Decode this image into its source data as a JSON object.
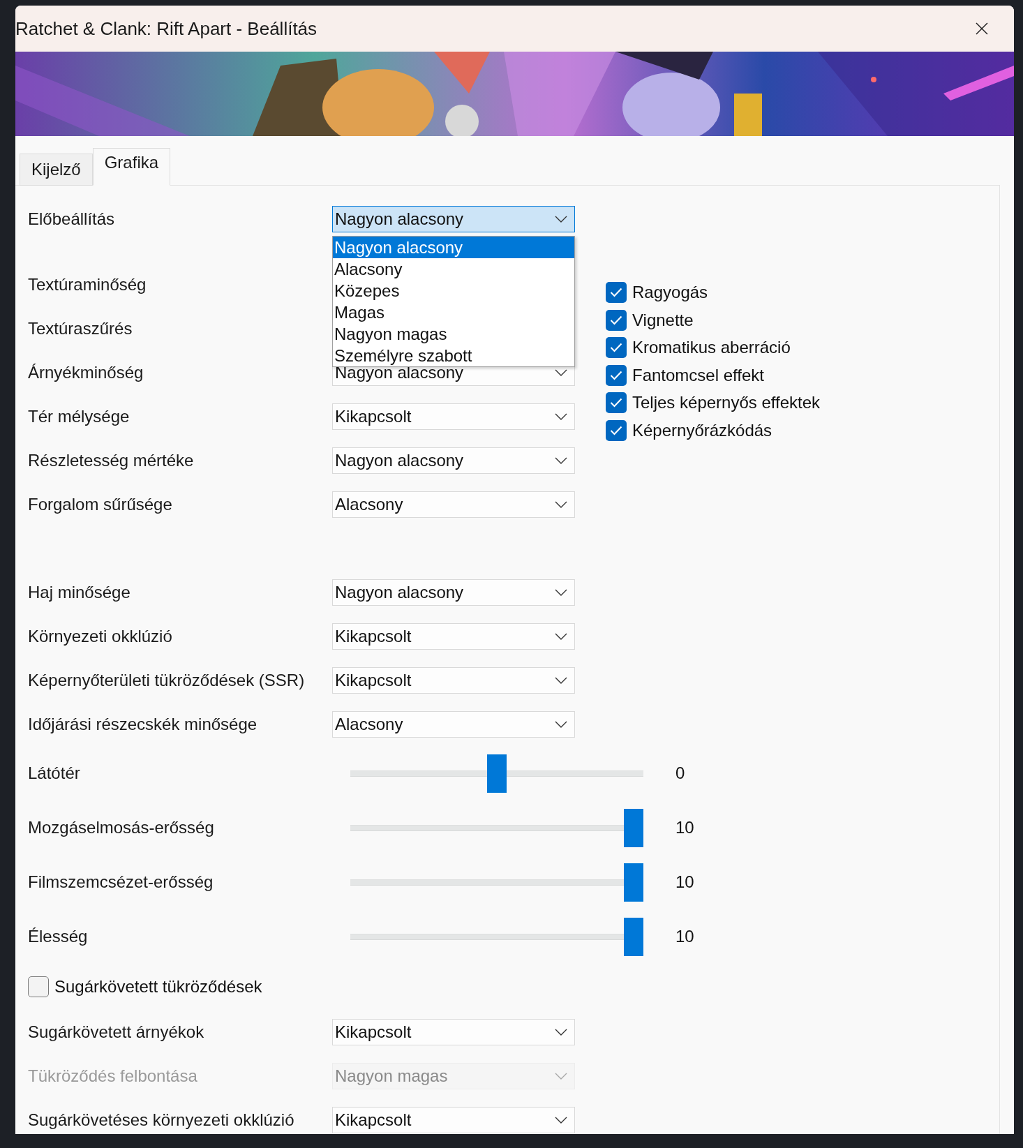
{
  "window": {
    "title": "Ratchet & Clank: Rift Apart - Beállítás"
  },
  "tabs": [
    {
      "label": "Kijelző",
      "selected": false
    },
    {
      "label": "Grafika",
      "selected": true
    }
  ],
  "settings": {
    "groups": [
      [
        {
          "kind": "dropdown",
          "label": "Előbeállítás",
          "value": "Nagyon alacsony",
          "disabled": false,
          "open": true,
          "options": [
            {
              "label": "Nagyon alacsony",
              "selected": true
            },
            {
              "label": "Alacsony",
              "selected": false
            },
            {
              "label": "Közepes",
              "selected": false
            },
            {
              "label": "Magas",
              "selected": false
            },
            {
              "label": "Nagyon magas",
              "selected": false
            },
            {
              "label": "Személyre szabott",
              "selected": false
            }
          ]
        },
        {
          "kind": "dropdown",
          "label": "Textúraminőség",
          "disabled": false
        },
        {
          "kind": "dropdown",
          "label": "Textúraszűrés",
          "disabled": false
        },
        {
          "kind": "dropdown",
          "label": "Árnyékminőség",
          "value": "Nagyon alacsony",
          "disabled": false
        },
        {
          "kind": "dropdown",
          "label": "Tér mélysége",
          "value": "Kikapcsolt",
          "disabled": false
        },
        {
          "kind": "dropdown",
          "label": "Részletesség mértéke",
          "value": "Nagyon alacsony",
          "disabled": false
        },
        {
          "kind": "dropdown",
          "label": "Forgalom sűrűsége",
          "value": "Alacsony",
          "disabled": false
        }
      ],
      [
        {
          "kind": "dropdown",
          "label": "Haj minősége",
          "value": "Nagyon alacsony",
          "disabled": false
        },
        {
          "kind": "dropdown",
          "label": "Környezeti okklúzió",
          "value": "Kikapcsolt",
          "disabled": false
        },
        {
          "kind": "dropdown",
          "label": "Képernyőterületi tükröződések (SSR)",
          "value": "Kikapcsolt",
          "disabled": false
        },
        {
          "kind": "dropdown",
          "label": "Időjárási részecskék minősége",
          "value": "Alacsony",
          "disabled": false
        },
        {
          "kind": "slider",
          "label": "Látótér",
          "level": 0.5,
          "reading": "0"
        },
        {
          "kind": "slider",
          "label": "Mozgáselmosás-erősség",
          "level": 1,
          "reading": "10"
        },
        {
          "kind": "slider",
          "label": "Filmszemcsézet-erősség",
          "level": 1,
          "reading": "10"
        },
        {
          "kind": "slider",
          "label": "Élesség",
          "level": 1,
          "reading": "10"
        },
        {
          "kind": "checkbox",
          "label": "Sugárkövetett tükröződések",
          "checked": false
        },
        {
          "kind": "dropdown",
          "label": "Sugárkövetett árnyékok",
          "value": "Kikapcsolt",
          "disabled": false
        },
        {
          "kind": "dropdown",
          "label": "Tükröződés felbontása",
          "value": "Nagyon magas",
          "disabled": true
        },
        {
          "kind": "dropdown",
          "label": "Sugárkövetéses környezeti okklúzió",
          "value": "Kikapcsolt",
          "disabled": false
        }
      ]
    ],
    "effects": [
      {
        "label": "Ragyogás",
        "checked": true
      },
      {
        "label": "Vignette",
        "checked": true
      },
      {
        "label": "Kromatikus aberráció",
        "checked": true
      },
      {
        "label": "Fantomcsel effekt",
        "checked": true
      },
      {
        "label": "Teljes képernyős effektek",
        "checked": true
      },
      {
        "label": "Képernyőrázkódás",
        "checked": true
      }
    ]
  }
}
